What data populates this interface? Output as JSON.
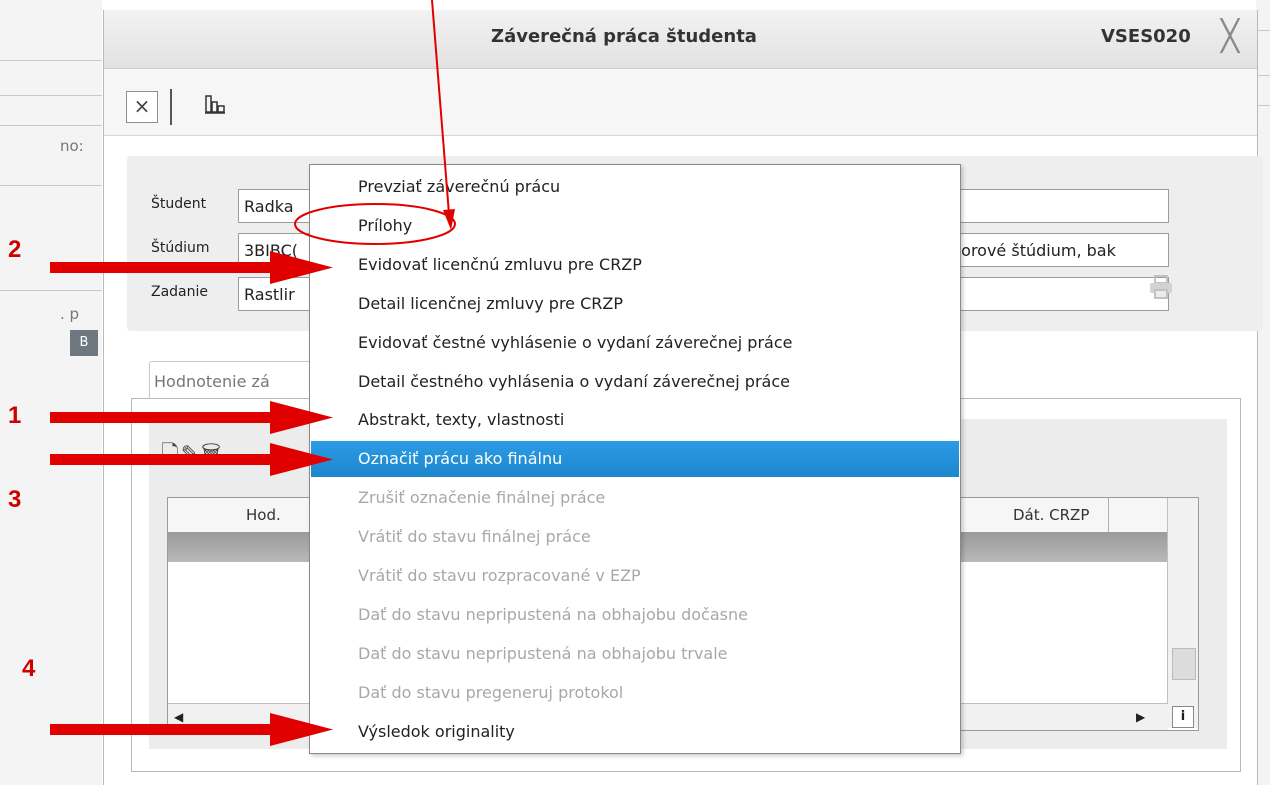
{
  "background_app": {
    "fragments": [
      "no:",
      ". p"
    ],
    "chip": "B"
  },
  "dialog": {
    "title": "Záverečná práca študenta",
    "form_code": "VSES020",
    "close_glyph": "╳"
  },
  "toolbar": {
    "close_glyph": "×",
    "org_glyph": "🏢"
  },
  "info": {
    "student_label": "Študent",
    "student_value": "Radka",
    "study_label": "Štúdium",
    "study_value": "3BIBC(",
    "study_right_value": "porové štúdium, bak",
    "assignment_label": "Zadanie",
    "assignment_value": "Rastlir"
  },
  "tabs": {
    "active_label": "Hodnotenie zá"
  },
  "grid": {
    "tool_glyphs": "🗋✎🗑",
    "col_hod": "Hod.",
    "col_dat_crzp": "Dát. CRZP",
    "scroll_left": "◀",
    "scroll_right": "▶",
    "info": "i"
  },
  "context_menu": {
    "items": [
      {
        "label": "Prevziať záverečnú prácu",
        "state": "enabled"
      },
      {
        "label": "Prílohy",
        "state": "enabled"
      },
      {
        "label": "Evidovať licenčnú zmluvu pre CRZP",
        "state": "enabled"
      },
      {
        "label": "Detail licenčnej zmluvy pre CRZP",
        "state": "enabled"
      },
      {
        "label": "Evidovať čestné vyhlásenie o vydaní záverečnej práce",
        "state": "enabled"
      },
      {
        "label": "Detail čestného vyhlásenia o vydaní záverečnej práce",
        "state": "enabled"
      },
      {
        "label": "Abstrakt, texty, vlastnosti",
        "state": "enabled"
      },
      {
        "label": "Označiť prácu ako finálnu",
        "state": "selected"
      },
      {
        "label": "Zrušiť označenie finálnej práce",
        "state": "disabled"
      },
      {
        "label": "Vrátiť do stavu finálnej práce",
        "state": "disabled"
      },
      {
        "label": "Vrátiť do stavu rozpracované v EZP",
        "state": "disabled"
      },
      {
        "label": "Dať do stavu nepripustená na obhajobu dočasne",
        "state": "disabled"
      },
      {
        "label": "Dať do stavu nepripustená na obhajobu trvale",
        "state": "disabled"
      },
      {
        "label": "Dať do stavu pregeneruj protokol",
        "state": "disabled"
      },
      {
        "label": "Výsledok originality",
        "state": "enabled"
      }
    ]
  },
  "annotations": {
    "color": "#e00000",
    "n1": "1",
    "n2": "2",
    "n3": "3",
    "n4": "4"
  },
  "colors": {
    "menu_selected": "#1f8ad3",
    "disabled_text": "#a8a8a8"
  }
}
